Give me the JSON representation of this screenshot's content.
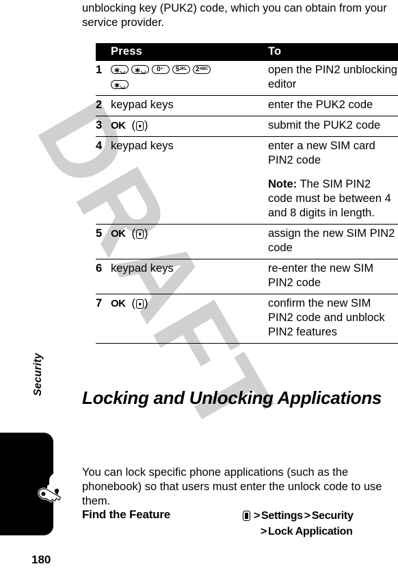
{
  "page": {
    "number": "180",
    "side_tab_label": "Security",
    "watermark": "DRAFT",
    "lock_icon": "lock-and-key-icon"
  },
  "intro": {
    "paragraph": "unblocking key (PUK2) code, which you can obtain from your service provider."
  },
  "procedure_table": {
    "headers": {
      "num": "",
      "press": "Press",
      "to": "To"
    },
    "rows": [
      {
        "num": "1",
        "press_type": "keys",
        "keys_line1": [
          {
            "digit": "∗",
            "sub": "◡",
            "name": "star-key"
          },
          {
            "digit": "∗",
            "sub": "◡",
            "name": "star-key"
          },
          {
            "digit": "0",
            "sub": "+↑",
            "name": "zero-key"
          },
          {
            "digit": "5",
            "sub": "JKL",
            "name": "five-key"
          },
          {
            "digit": "2",
            "sub": "ABC",
            "name": "two-key"
          }
        ],
        "keys_line2": [
          {
            "digit": "∗",
            "sub": "◡",
            "name": "star-key"
          }
        ],
        "to": "open the PIN2 unblocking editor"
      },
      {
        "num": "2",
        "press_type": "text",
        "press": "keypad keys",
        "to": "enter the PUK2 code"
      },
      {
        "num": "3",
        "press_type": "softkey",
        "press": "OK",
        "to": "submit the PUK2 code"
      },
      {
        "num": "4",
        "press_type": "text",
        "press": "keypad keys",
        "to": "enter a new SIM card PIN2 code",
        "note_label": "Note:",
        "note_text": " The SIM PIN2 code must be between 4 and 8 digits in length."
      },
      {
        "num": "5",
        "press_type": "softkey",
        "press": "OK",
        "to": "assign the new SIM PIN2 code"
      },
      {
        "num": "6",
        "press_type": "text",
        "press": "keypad keys",
        "to": "re-enter the new SIM PIN2 code"
      },
      {
        "num": "7",
        "press_type": "softkey",
        "press": "OK",
        "to": "confirm the new SIM PIN2 code and unblock PIN2 features"
      }
    ]
  },
  "section": {
    "heading": "Locking and Unlocking Applications",
    "paragraph": "You can lock specific phone applications (such as the phonebook) so that users must enter the unlock code to use them."
  },
  "find_feature": {
    "label": "Find the Feature",
    "menu_icon": "menu-icon",
    "line1_sep": ">",
    "line1_item1": "Settings",
    "line1_sep2": ">",
    "line1_item2": "Security",
    "line2_sep": ">",
    "line2_item": "Lock Application"
  },
  "colors": {
    "text": "#000000",
    "header_band_bg": "#000000",
    "header_band_fg": "#ffffff",
    "watermark": "#c8c8c8",
    "page_bg": "#ffffff"
  }
}
